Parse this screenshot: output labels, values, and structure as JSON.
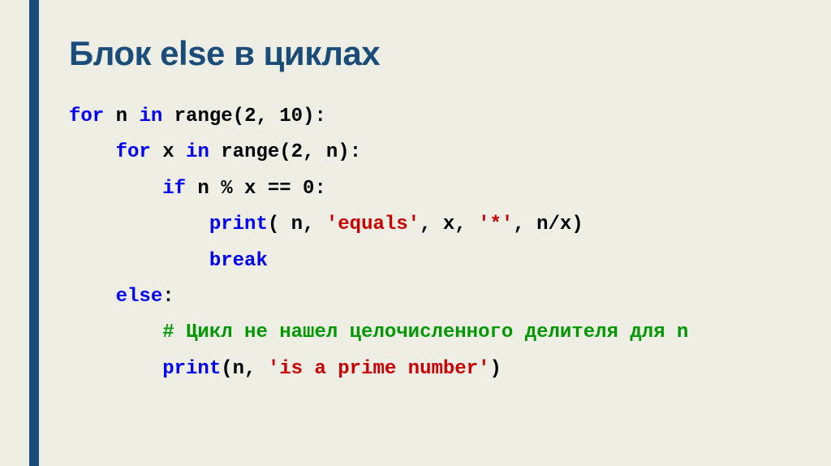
{
  "title": "Блок else в циклах",
  "code": {
    "l1_for": "for",
    "l1_rest": " n ",
    "l1_in": "in",
    "l1_range": " range(2, 10):",
    "l2_indent": "    ",
    "l2_for": "for",
    "l2_x": " x ",
    "l2_in": "in",
    "l2_range": " range(2, n):",
    "l3_indent": "        ",
    "l3_if": "if",
    "l3_cond": " n % x == 0:",
    "l4_indent": "            ",
    "l4_print": "print",
    "l4_open": "( n, ",
    "l4_str1": "'equals'",
    "l4_mid": ", x, ",
    "l4_str2": "'*'",
    "l4_end": ", n/x)",
    "l5_indent": "            ",
    "l5_break": "break",
    "l6_indent": "    ",
    "l6_else": "else",
    "l6_colon": ":",
    "l7_indent": "        ",
    "l7_comment": "# Цикл не нашел целочисленного делителя для n",
    "l8_indent": "        ",
    "l8_print": "print",
    "l8_open": "(n, ",
    "l8_str": "'is a prime number'",
    "l8_close": ")"
  }
}
